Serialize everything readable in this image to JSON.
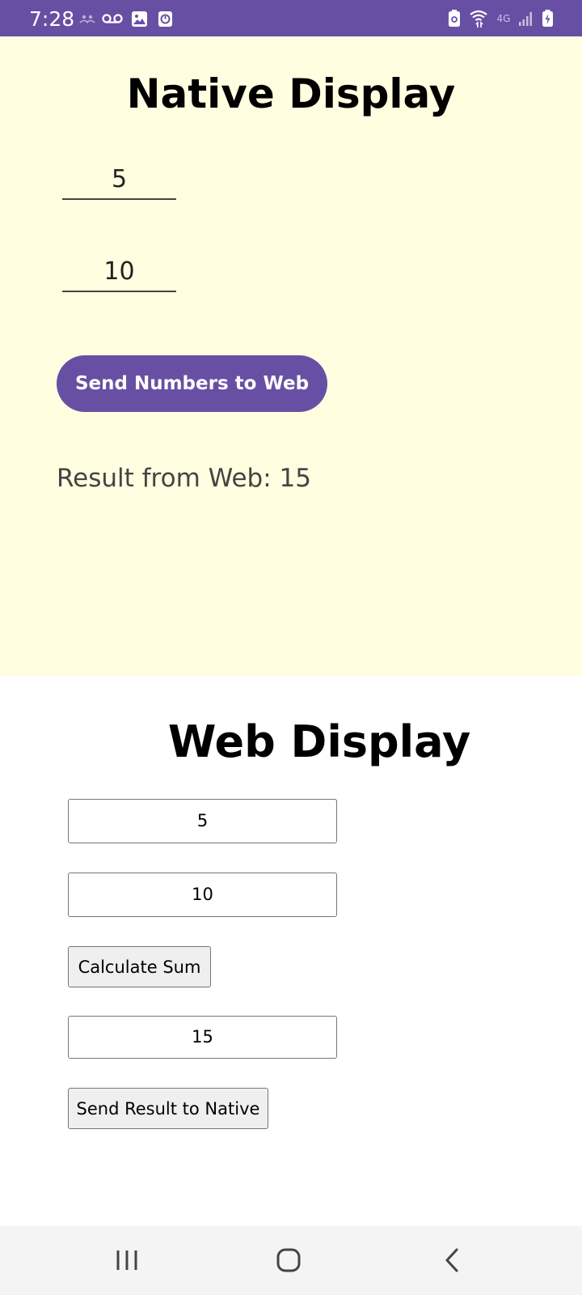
{
  "status_bar": {
    "time": "7:28",
    "background_color": "#6750a4",
    "left_icons": [
      "people-icon",
      "voicemail-icon",
      "image-icon",
      "clock-app-icon"
    ],
    "right_icons": [
      "battery-saver-icon",
      "wifi-icon",
      "4g-icon",
      "signal-icon",
      "battery-charging-icon"
    ],
    "network_label": "4G"
  },
  "native": {
    "background_color": "#fffee0",
    "title": "Native Display",
    "field1_value": "5",
    "field2_value": "10",
    "send_button_label": "Send Numbers to Web",
    "send_button_color": "#6750a4",
    "result_text": "Result from Web: 15"
  },
  "web": {
    "background_color": "#ffffff",
    "title": "Web Display",
    "input1_value": "5",
    "input2_value": "10",
    "calculate_label": "Calculate Sum",
    "result_value": "15",
    "send_result_label": "Send Result to Native"
  },
  "nav_bar": {
    "icons": [
      "recents-icon",
      "home-icon",
      "back-icon"
    ]
  }
}
